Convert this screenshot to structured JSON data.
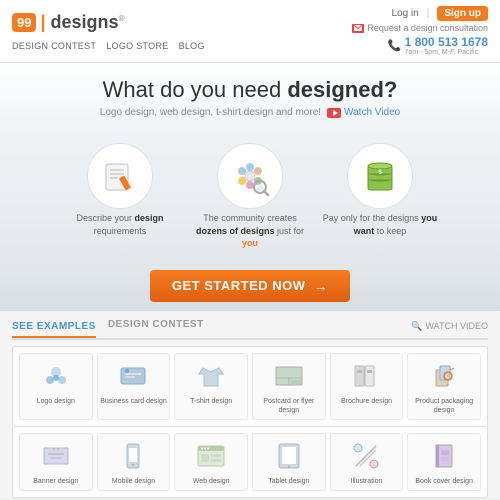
{
  "header": {
    "logo_badge": "99",
    "logo_text": "designs",
    "logo_reg": "®",
    "nav": [
      {
        "label": "DESIGN CONTEST"
      },
      {
        "label": "LOGO STORE"
      },
      {
        "label": "BLOG"
      }
    ],
    "login_label": "Log in",
    "signup_label": "Sign up",
    "consultation_label": "Request a design consultation",
    "phone": "1 800 513 1678",
    "phone_sub": "7am - 5pm, M-F, Pacific"
  },
  "hero": {
    "headline_part1": "What do you need ",
    "headline_part2": "designed?",
    "subtext": "Logo design, web design, t-shirt design and more!",
    "watch_video_label": "Watch Video"
  },
  "steps": [
    {
      "description_before": "Describe your ",
      "description_bold": "design",
      "description_after": " requirements"
    },
    {
      "description_before": "The community creates ",
      "description_bold": "dozens of designs",
      "description_after": " just for ",
      "description_you": "you"
    },
    {
      "description_before": "Pay only for the designs ",
      "description_bold": "you want",
      "description_after": " to keep"
    }
  ],
  "cta": {
    "button_label": "GET STARTED NOW",
    "arrow": "→"
  },
  "examples": {
    "tab_active": "SEE EXAMPLES",
    "tab_inactive": "DESIGN CONTEST",
    "watch_video": "WATCH VIDEO",
    "items_row1": [
      {
        "label": "Logo design"
      },
      {
        "label": "Business card design"
      },
      {
        "label": "T-shirt design"
      },
      {
        "label": "Postcard or flyer design"
      },
      {
        "label": "Brochure design"
      },
      {
        "label": "Product packaging design"
      }
    ],
    "items_row2": [
      {
        "label": "Banner design"
      },
      {
        "label": "Mobile design"
      },
      {
        "label": "Web design"
      },
      {
        "label": "Tablet design"
      },
      {
        "label": "Illustration"
      },
      {
        "label": "Book cover design"
      }
    ]
  }
}
